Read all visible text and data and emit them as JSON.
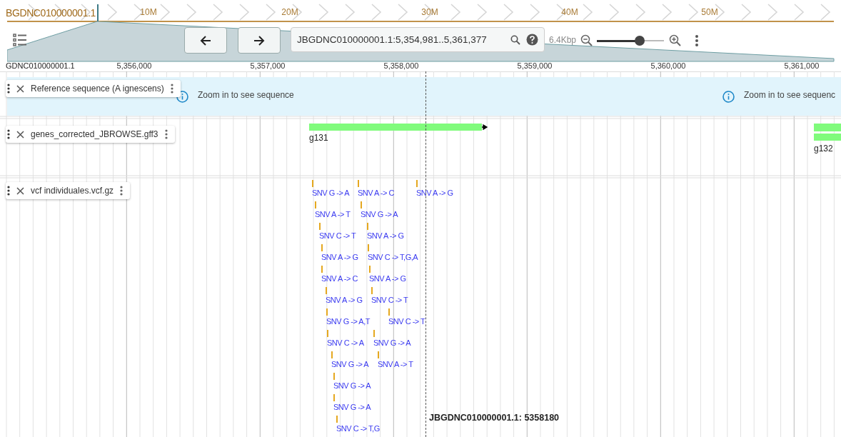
{
  "overview": {
    "sequence": "BGDNC010000001.1",
    "ticks": [
      "10M",
      "20M",
      "30M",
      "40M",
      "50M"
    ]
  },
  "toolbar": {
    "location": "JBGDNC010000001.1:5,354,981..5,361,377",
    "zoom_span": "6.4Kbp",
    "zoom": {
      "level": 0.64
    }
  },
  "ruler": {
    "sequence": "GDNC010000001.1",
    "ticks": [
      "5,356,000",
      "5,357,000",
      "5,358,000",
      "5,359,000",
      "5,360,000",
      "5,361,000"
    ]
  },
  "tracks": [
    {
      "kind": "reference",
      "name": "Reference sequence (A ignescens)",
      "messages": [
        "Zoom in to see sequence",
        "Zoom in to see sequenc"
      ]
    },
    {
      "kind": "genes",
      "name": "genes_corrected_JBROWSE.gff3",
      "features": [
        {
          "label": "g131"
        },
        {
          "label": "g132"
        }
      ]
    },
    {
      "kind": "variants",
      "name": "vcf individuales.vcf.gz",
      "features": [
        {
          "label": "SNV G -> A"
        },
        {
          "label": "SNV A -> C"
        },
        {
          "label": "SNV A -> G"
        },
        {
          "label": "SNV A -> T"
        },
        {
          "label": "SNV G -> A"
        },
        {
          "label": "SNV C -> T"
        },
        {
          "label": "SNV A -> G"
        },
        {
          "label": "SNV A -> G"
        },
        {
          "label": "SNV C -> T,G,A"
        },
        {
          "label": "SNV A -> C"
        },
        {
          "label": "SNV A -> G"
        },
        {
          "label": "SNV A -> G"
        },
        {
          "label": "SNV C -> T"
        },
        {
          "label": "SNV G -> A,T"
        },
        {
          "label": "SNV C -> T"
        },
        {
          "label": "SNV C -> A"
        },
        {
          "label": "SNV G -> A"
        },
        {
          "label": "SNV G -> A"
        },
        {
          "label": "SNV A -> T"
        },
        {
          "label": "SNV G -> A"
        },
        {
          "label": "SNV G -> A"
        },
        {
          "label": "SNV C -> T,G"
        }
      ]
    }
  ],
  "cursor": {
    "label": "JBGDNC010000001.1: 5358180"
  }
}
